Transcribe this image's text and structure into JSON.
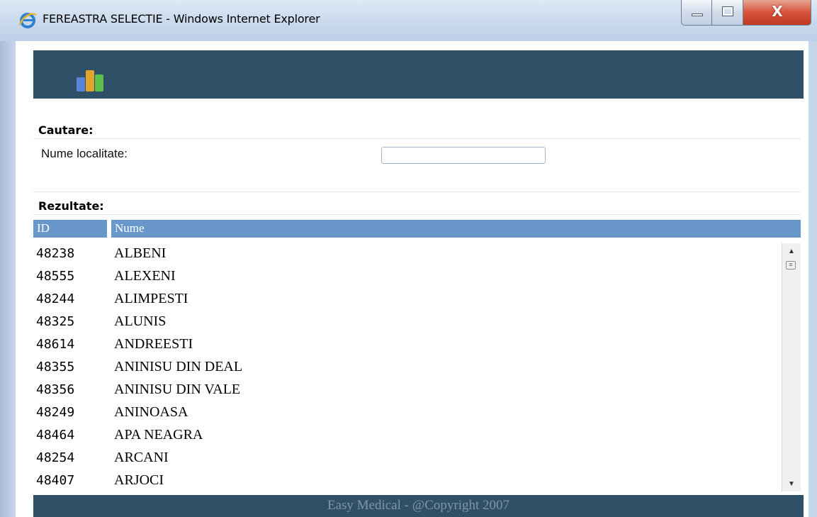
{
  "window": {
    "title": "FEREASTRA SELECTIE - Windows Internet Explorer",
    "close_glyph": "X",
    "icon": "ie-icon"
  },
  "header": {
    "logo_icon": "bar-chart-logo-icon",
    "logo_colors": [
      "#5b84d9",
      "#e0a62c",
      "#5cc04a"
    ]
  },
  "search": {
    "section_label": "Cautare:",
    "field_label": "Nume localitate:",
    "value": ""
  },
  "results": {
    "section_label": "Rezultate:",
    "columns": [
      "ID",
      "Nume"
    ],
    "rows": [
      {
        "id": "48238",
        "name": "ALBENI"
      },
      {
        "id": "48555",
        "name": "ALEXENI"
      },
      {
        "id": "48244",
        "name": "ALIMPESTI"
      },
      {
        "id": "48325",
        "name": "ALUNIS"
      },
      {
        "id": "48614",
        "name": "ANDREESTI"
      },
      {
        "id": "48355",
        "name": "ANINISU DIN DEAL"
      },
      {
        "id": "48356",
        "name": "ANINISU DIN VALE"
      },
      {
        "id": "48249",
        "name": "ANINOASA"
      },
      {
        "id": "48464",
        "name": "APA NEAGRA"
      },
      {
        "id": "48254",
        "name": "ARCANI"
      },
      {
        "id": "48407",
        "name": "ARJOCI"
      }
    ]
  },
  "footer": {
    "text": "Easy Medical - @Copyright 2007"
  },
  "colors": {
    "header_band": "#2f5066",
    "table_header": "#6a97c9"
  }
}
